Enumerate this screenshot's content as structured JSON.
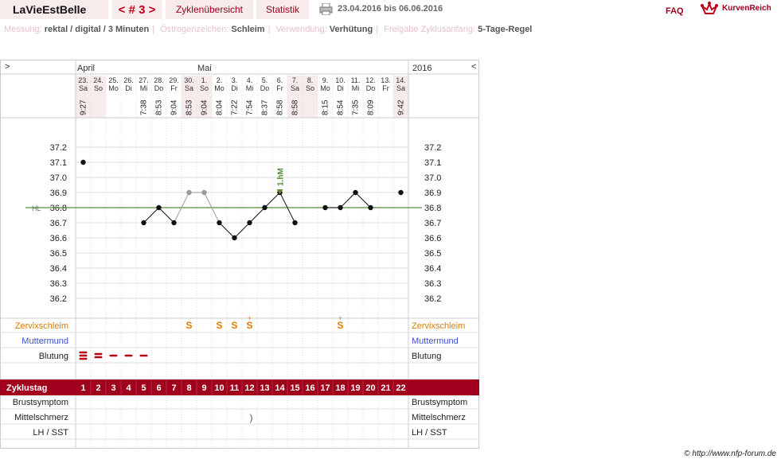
{
  "header": {
    "brand": "LaVieEstBelle",
    "cycle_nav": "< # 3 >",
    "tabs": [
      "Zyklenübersicht",
      "Statistik"
    ],
    "date_range": "23.04.2016 bis 06.06.2016",
    "faq": "FAQ",
    "logo": "KurvenReich"
  },
  "info": [
    {
      "key": "Messung:",
      "value": "rektal / digital / 3 Minuten"
    },
    {
      "key": "Östrogenzeichen:",
      "value": "Schleim"
    },
    {
      "key": "Verwendung:",
      "value": "Verhütung"
    },
    {
      "key": "Freigabe Zyklusanfang:",
      "value": "5-Tage-Regel"
    }
  ],
  "grid": {
    "nav_left": ">",
    "nav_right": "<",
    "month_april": "April",
    "month_may": "Mai",
    "year": "2016",
    "hl_label": "HL"
  },
  "days": [
    {
      "date": "23.",
      "wd": "Sa",
      "time": "9:27",
      "temp": 37.1,
      "grey": false,
      "weekend": true
    },
    {
      "date": "24.",
      "wd": "So",
      "time": "",
      "temp": null,
      "grey": false,
      "weekend": true
    },
    {
      "date": "25.",
      "wd": "Mo",
      "time": "",
      "temp": null,
      "grey": false,
      "weekend": false
    },
    {
      "date": "26.",
      "wd": "Di",
      "time": "",
      "temp": null,
      "grey": false,
      "weekend": false
    },
    {
      "date": "27.",
      "wd": "Mi",
      "time": "7:38",
      "temp": 36.7,
      "grey": false,
      "weekend": false
    },
    {
      "date": "28.",
      "wd": "Do",
      "time": "8:53",
      "temp": 36.8,
      "grey": false,
      "weekend": false
    },
    {
      "date": "29.",
      "wd": "Fr",
      "time": "9:04",
      "temp": 36.7,
      "grey": false,
      "weekend": false
    },
    {
      "date": "30.",
      "wd": "Sa",
      "time": "8:53",
      "temp": 36.9,
      "grey": true,
      "weekend": true
    },
    {
      "date": "1.",
      "wd": "So",
      "time": "9:04",
      "temp": 36.9,
      "grey": true,
      "weekend": true
    },
    {
      "date": "2.",
      "wd": "Mo",
      "time": "8:04",
      "temp": 36.7,
      "grey": false,
      "weekend": false
    },
    {
      "date": "3.",
      "wd": "Di",
      "time": "7:22",
      "temp": 36.6,
      "grey": false,
      "weekend": false
    },
    {
      "date": "4.",
      "wd": "Mi",
      "time": "7:54",
      "temp": 36.7,
      "grey": false,
      "weekend": false
    },
    {
      "date": "5.",
      "wd": "Do",
      "time": "8:37",
      "temp": 36.8,
      "grey": false,
      "weekend": false
    },
    {
      "date": "6.",
      "wd": "Fr",
      "time": "8:58",
      "temp": 36.9,
      "grey": false,
      "weekend": false
    },
    {
      "date": "7.",
      "wd": "Sa",
      "time": "8:58",
      "temp": 36.7,
      "grey": false,
      "weekend": true
    },
    {
      "date": "8.",
      "wd": "So",
      "time": "",
      "temp": null,
      "grey": false,
      "weekend": true
    },
    {
      "date": "9.",
      "wd": "Mo",
      "time": "8:15",
      "temp": 36.8,
      "grey": false,
      "weekend": false
    },
    {
      "date": "10.",
      "wd": "Di",
      "time": "8:54",
      "temp": 36.8,
      "grey": false,
      "weekend": false
    },
    {
      "date": "11.",
      "wd": "Mi",
      "time": "7:35",
      "temp": 36.9,
      "grey": false,
      "weekend": false
    },
    {
      "date": "12.",
      "wd": "Do",
      "time": "8:09",
      "temp": 36.8,
      "grey": false,
      "weekend": false
    },
    {
      "date": "13.",
      "wd": "Fr",
      "time": "",
      "temp": null,
      "grey": false,
      "weekend": false
    },
    {
      "date": "14.",
      "wd": "Sa",
      "time": "9:42",
      "temp": 36.9,
      "grey": false,
      "weekend": true
    }
  ],
  "chart_data": {
    "type": "line",
    "title": "",
    "x": [
      "23.",
      "24.",
      "25.",
      "26.",
      "27.",
      "28.",
      "29.",
      "30.",
      "1.",
      "2.",
      "3.",
      "4.",
      "5.",
      "6.",
      "7.",
      "8.",
      "9.",
      "10.",
      "11.",
      "12.",
      "13.",
      "14."
    ],
    "series": [
      {
        "values": [
          37.1,
          null,
          null,
          null,
          36.7,
          36.8,
          36.7,
          36.9,
          36.9,
          36.7,
          36.6,
          36.7,
          36.8,
          36.9,
          36.7,
          null,
          36.8,
          36.8,
          36.9,
          36.8,
          null,
          36.9
        ]
      }
    ],
    "y_ticks": [
      37.2,
      37.1,
      37.0,
      36.9,
      36.8,
      36.7,
      36.6,
      36.5,
      36.4,
      36.3,
      36.2
    ],
    "ylim": [
      36.2,
      37.2
    ],
    "hl": 36.8,
    "peak": {
      "day": 14,
      "label": "1.hM"
    },
    "grid": true
  },
  "row_labels": {
    "zervix": "Zervixschleim",
    "muttermund": "Muttermund",
    "blutung": "Blutung",
    "zyklustag": "Zyklustag",
    "brust": "Brustsymptom",
    "mittel": "Mittelschmerz",
    "lh": "LH / SST"
  },
  "cycle_days": [
    "1",
    "2",
    "3",
    "4",
    "5",
    "6",
    "7",
    "8",
    "9",
    "10",
    "11",
    "12",
    "13",
    "14",
    "15",
    "16",
    "17",
    "18",
    "19",
    "20",
    "21",
    "22"
  ],
  "zervix": [
    {
      "day": 8,
      "label": "S"
    },
    {
      "day": 10,
      "label": "S"
    },
    {
      "day": 11,
      "label": "S"
    },
    {
      "day": 12,
      "label": "S+"
    },
    {
      "day": 18,
      "label": "S+"
    }
  ],
  "blutung": [
    {
      "day": 1,
      "level": 3
    },
    {
      "day": 2,
      "level": 2
    },
    {
      "day": 3,
      "level": 1
    },
    {
      "day": 4,
      "level": 1
    },
    {
      "day": 5,
      "level": 1
    }
  ],
  "mittelschmerz": [
    {
      "day": 12,
      "mark": ")"
    }
  ],
  "colors": {
    "accent": "#a0001c",
    "zervix": "#e07b00",
    "muttermund": "#4050c8",
    "hl": "#5a8a3a",
    "weekend": "#f7ebec",
    "grid": "#dddddd"
  },
  "credit": "© http://www.nfp-forum.de"
}
